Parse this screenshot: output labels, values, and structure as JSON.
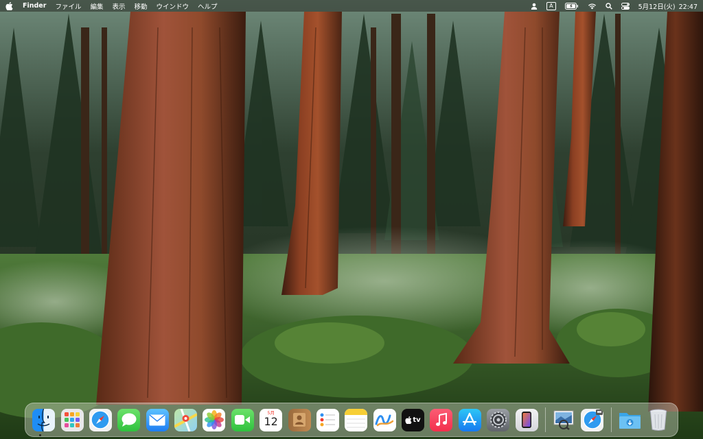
{
  "menubar": {
    "apple_icon": "apple-logo-icon",
    "app_name": "Finder",
    "menus": [
      "ファイル",
      "編集",
      "表示",
      "移動",
      "ウインドウ",
      "ヘルプ"
    ],
    "status_icons": [
      "user-icon",
      "input-source-icon",
      "battery-icon",
      "wifi-icon",
      "spotlight-search-icon",
      "control-center-icon"
    ],
    "input_source_label": "A",
    "date": "5月12日(火)",
    "time": "22:47"
  },
  "calendar_icon": {
    "month": "5月",
    "day": "12"
  },
  "appletv_icon": {
    "label": "tv"
  },
  "dock": {
    "apps": [
      {
        "name": "Finder",
        "icon": "finder-icon",
        "running": true
      },
      {
        "name": "Launchpad",
        "icon": "launchpad-icon"
      },
      {
        "name": "Safari",
        "icon": "safari-icon"
      },
      {
        "name": "Messages",
        "icon": "messages-icon"
      },
      {
        "name": "Mail",
        "icon": "mail-icon"
      },
      {
        "name": "Maps",
        "icon": "maps-icon"
      },
      {
        "name": "Photos",
        "icon": "photos-icon"
      },
      {
        "name": "FaceTime",
        "icon": "facetime-icon"
      },
      {
        "name": "Calendar",
        "icon": "calendar-icon"
      },
      {
        "name": "Contacts",
        "icon": "contacts-icon"
      },
      {
        "name": "Reminders",
        "icon": "reminders-icon"
      },
      {
        "name": "Notes",
        "icon": "notes-icon"
      },
      {
        "name": "Freeform",
        "icon": "freeform-icon"
      },
      {
        "name": "Apple TV",
        "icon": "apple-tv-icon"
      },
      {
        "name": "Music",
        "icon": "music-icon"
      },
      {
        "name": "App Store",
        "icon": "app-store-icon"
      },
      {
        "name": "System Settings",
        "icon": "system-settings-icon"
      },
      {
        "name": "iPhone Mirroring",
        "icon": "iphone-mirroring-icon"
      }
    ],
    "recent": [
      {
        "name": "Preview",
        "icon": "preview-icon"
      },
      {
        "name": "Safari Web App",
        "icon": "safari-web-app-icon"
      }
    ],
    "stacks": [
      {
        "name": "Downloads",
        "icon": "downloads-folder-icon"
      },
      {
        "name": "Trash",
        "icon": "trash-icon"
      }
    ]
  }
}
